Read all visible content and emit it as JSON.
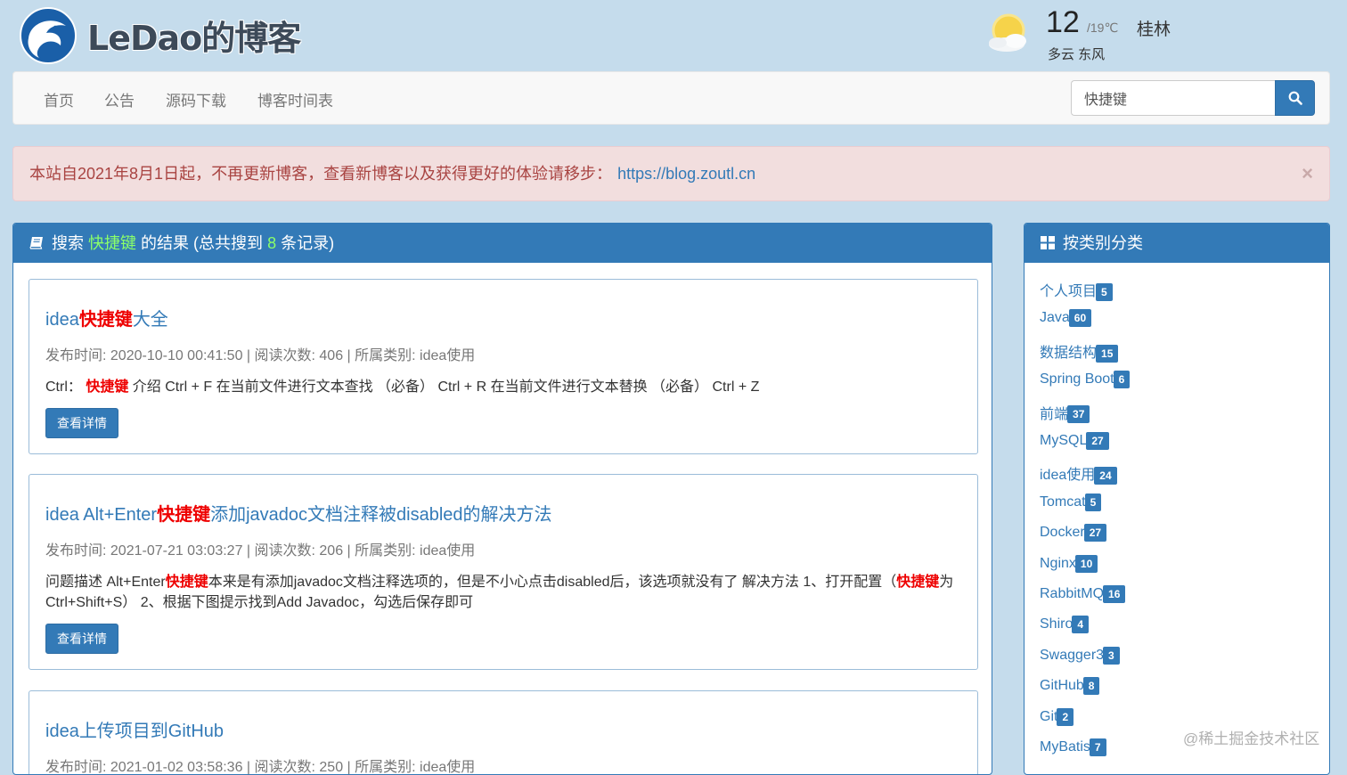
{
  "header": {
    "logo_text": "LeDao的博客",
    "weather": {
      "temp": "12",
      "range": "/19℃",
      "city": "桂林",
      "condition": "多云 东风"
    }
  },
  "nav": {
    "items": [
      "首页",
      "公告",
      "源码下载",
      "博客时间表"
    ],
    "search_value": "快捷键"
  },
  "alert": {
    "text": "本站自2021年8月1日起，不再更新博客，查看新博客以及获得更好的体验请移步：",
    "link": "https://blog.zoutl.cn",
    "close": "×"
  },
  "results_panel": {
    "prefix": "搜索",
    "keyword": "快捷键",
    "middle": "的结果 (总共搜到",
    "count": "8",
    "suffix": "条记录)"
  },
  "results": [
    {
      "title_pre": "idea",
      "title_hl": "快捷键",
      "title_post": "大全",
      "meta": "发布时间: 2020-10-10 00:41:50 | 阅读次数: 406 | 所属类别: idea使用",
      "summary_pre": "Ctrl： ",
      "summary_hl": "快捷键",
      "summary_post": " 介绍 Ctrl + F 在当前文件进行文本查找 （必备） Ctrl + R 在当前文件进行文本替换 （必备） Ctrl + Z",
      "button": "查看详情"
    },
    {
      "title_pre": "idea Alt+Enter",
      "title_hl": "快捷键",
      "title_post": "添加javadoc文档注释被disabled的解决方法",
      "meta": "发布时间: 2021-07-21 03:03:27 | 阅读次数: 206 | 所属类别: idea使用",
      "summary_1": "问题描述 Alt+Enter",
      "summary_hl1": "快捷键",
      "summary_2": "本来是有添加javadoc文档注释选项的，但是不小心点击disabled后，该选项就没有了 解决方法 1、打开配置（",
      "summary_hl2": "快捷键",
      "summary_3": "为Ctrl+Shift+S） 2、根据下图提示找到Add Javadoc，勾选后保存即可",
      "button": "查看详情"
    },
    {
      "title": "idea上传项目到GitHub",
      "meta": "发布时间: 2021-01-02 03:58:36 | 阅读次数: 250 | 所属类别: idea使用"
    }
  ],
  "categories_panel": {
    "title": "按类别分类",
    "items": [
      {
        "name": "个人项目",
        "count": "5"
      },
      {
        "name": "Java",
        "count": "60"
      },
      {
        "name": "数据结构",
        "count": "15"
      },
      {
        "name": "Spring Boot",
        "count": "6"
      },
      {
        "name": "前端",
        "count": "37"
      },
      {
        "name": "MySQL",
        "count": "27"
      },
      {
        "name": "idea使用",
        "count": "24"
      },
      {
        "name": "Tomcat",
        "count": "5"
      },
      {
        "name": "Docker",
        "count": "27"
      },
      {
        "name": "Nginx",
        "count": "10"
      },
      {
        "name": "RabbitMQ",
        "count": "16"
      },
      {
        "name": "Shiro",
        "count": "4"
      },
      {
        "name": "Swagger3",
        "count": "3"
      },
      {
        "name": "GitHub",
        "count": "8"
      },
      {
        "name": "Git",
        "count": "2"
      },
      {
        "name": "MyBatis",
        "count": "7"
      }
    ]
  },
  "watermark": "@稀土掘金技术社区",
  "icons": {
    "logo": "dolphin-logo-icon",
    "weather": "partly-cloudy-icon",
    "search": "search-icon",
    "book": "book-icon",
    "grid": "th-large-icon"
  },
  "colors": {
    "primary": "#337ab7",
    "highlight": "#e00000",
    "count_green": "#8aff6a",
    "alert_bg": "#f2dede",
    "page_bg": "#c5dcec"
  }
}
